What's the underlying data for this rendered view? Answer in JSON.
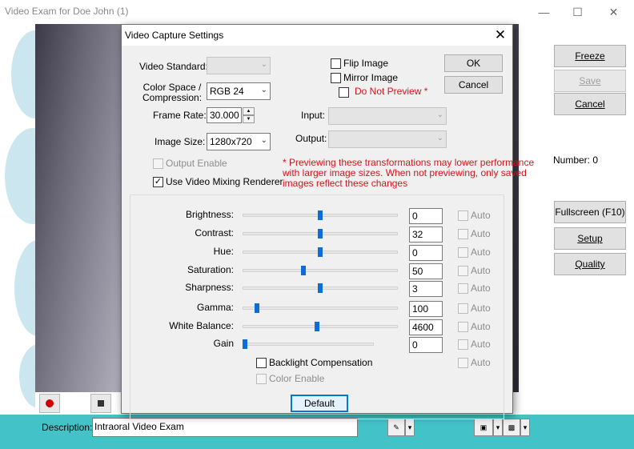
{
  "window": {
    "title": "Video Exam for Doe John (1)",
    "controls": [
      "minimize",
      "maximize",
      "close"
    ]
  },
  "side_buttons": {
    "freeze": "Freeze",
    "save": "Save",
    "cancel": "Cancel",
    "number": "Number: 0",
    "fullscreen": "Fullscreen (F10)",
    "setup": "Setup",
    "quality": "Quality"
  },
  "bottom": {
    "description_label": "Description:",
    "description_value": "Intraoral Video Exam"
  },
  "dialog": {
    "title": "Video Capture Settings",
    "video_standard_label": "Video Standard:",
    "video_standard_value": "",
    "color_space_label_line1": "Color Space /",
    "color_space_label_line2": "Compression:",
    "color_space_value": "RGB 24",
    "frame_rate_label": "Frame Rate:",
    "frame_rate_value": "30.000",
    "image_size_label": "Image Size:",
    "image_size_value": "1280x720",
    "output_enable_label": "Output Enable",
    "output_enable_checked": false,
    "use_vmr_label": "Use Video Mixing Renderer",
    "use_vmr_checked": true,
    "flip_image_label": "Flip Image",
    "flip_image_checked": false,
    "mirror_image_label": "Mirror Image",
    "mirror_image_checked": false,
    "do_not_preview_label": "Do Not Preview *",
    "do_not_preview_checked": false,
    "input_label": "Input:",
    "output_label": "Output:",
    "ok_label": "OK",
    "cancel_label": "Cancel",
    "note_line1": "* Previewing these transformations may lower performance",
    "note_line2": "with larger image sizes. When not previewing, only saved",
    "note_line3": "images reflect these changes",
    "auto_label": "Auto",
    "sliders": [
      {
        "label": "Brightness:",
        "value": "0",
        "position": 0.5
      },
      {
        "label": "Contrast:",
        "value": "32",
        "position": 0.5
      },
      {
        "label": "Hue:",
        "value": "0",
        "position": 0.5
      },
      {
        "label": "Saturation:",
        "value": "50",
        "position": 0.39
      },
      {
        "label": "Sharpness:",
        "value": "3",
        "position": 0.5
      },
      {
        "label": "Gamma:",
        "value": "100",
        "position": 0.08
      },
      {
        "label": "White Balance:",
        "value": "4600",
        "position": 0.48
      },
      {
        "label": "Gain",
        "value": "0",
        "position": 0.0
      }
    ],
    "backlight_label": "Backlight Compensation",
    "backlight_checked": false,
    "color_enable_label": "Color Enable",
    "default_label": "Default"
  }
}
